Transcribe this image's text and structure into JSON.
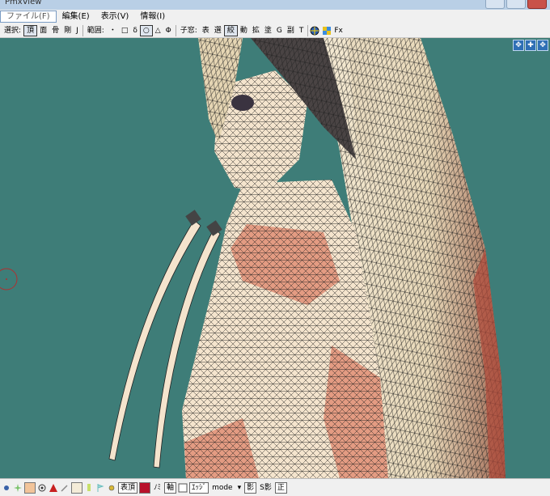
{
  "window": {
    "title": "PmxView"
  },
  "menu": [
    {
      "label": "ファイル(F)"
    },
    {
      "label": "編集(E)"
    },
    {
      "label": "表示(V)"
    },
    {
      "label": "情報(I)"
    }
  ],
  "toolbar": {
    "select_label": "選択:",
    "select_items": [
      "頂",
      "面",
      "骨",
      "剛",
      "J"
    ],
    "range_label": "範囲:",
    "range_items": [
      "・",
      "□",
      "δ",
      "○",
      "△",
      "Φ"
    ],
    "child_label": "子窓:",
    "child_items": [
      "表",
      "選",
      "絞",
      "動",
      "拡",
      "塗",
      "G",
      "副",
      "T"
    ],
    "fx_label": "Fx"
  },
  "statusbar": {
    "vertex_label": "表頂",
    "nomi_label": "ﾉﾐ",
    "axis_label": "軸",
    "edge_label": "ｴｯｼﾞ",
    "mode_label": "mode",
    "shadow_label": "影",
    "sshadow_label": "S影",
    "correct_label": "正"
  },
  "colors": {
    "background": "#3e7d78",
    "mesh_fill": "#f4e4cd",
    "skin": "#e39b82",
    "wire": "#1e1e1e"
  }
}
